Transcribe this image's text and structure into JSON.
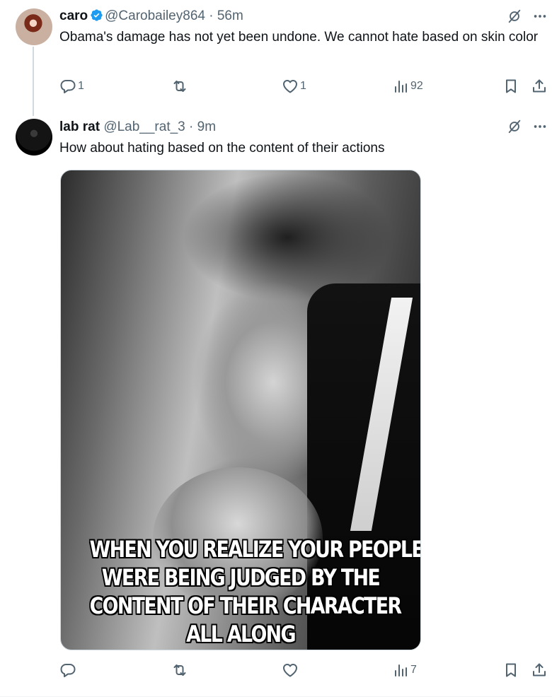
{
  "tweets": [
    {
      "name": "caro",
      "verified": true,
      "handle": "@Carobailey864",
      "separator": "·",
      "time": "56m",
      "text": "Obama's damage has not yet been undone. We cannot hate based on skin color",
      "stats": {
        "replies": "1",
        "retweets": "",
        "likes": "1",
        "views": "92"
      }
    },
    {
      "name": "lab rat",
      "verified": false,
      "handle": "@Lab__rat_3",
      "separator": "·",
      "time": "9m",
      "text": "How about hating based on the content of their actions",
      "media": {
        "caption_lines": [
          "WHEN YOU REALIZE YOUR PEOPLE",
          "WERE BEING JUDGED BY THE",
          "CONTENT OF THEIR CHARACTER",
          "ALL ALONG"
        ]
      },
      "stats": {
        "replies": "",
        "retweets": "",
        "likes": "",
        "views": "7"
      }
    }
  ],
  "colors": {
    "verified": "#1d9bf0",
    "muted": "#536471",
    "text": "#0f1419"
  }
}
